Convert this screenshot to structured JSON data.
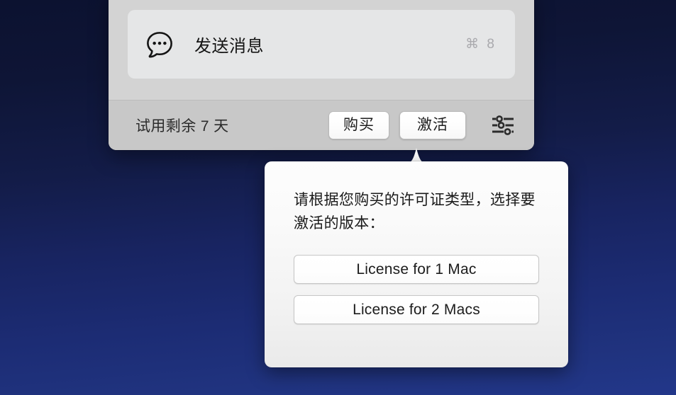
{
  "window": {
    "menu_item": {
      "icon": "chat-bubble-icon",
      "label": "发送消息",
      "shortcut": "⌘ 8"
    },
    "toolbar": {
      "trial_status": "试用剩余 7 天",
      "buy_label": "购买",
      "activate_label": "激活",
      "settings_icon": "sliders-icon"
    }
  },
  "popover": {
    "message": "请根据您购买的许可证类型，选择要激活的版本：",
    "options": [
      {
        "label": "License for 1 Mac"
      },
      {
        "label": "License for 2 Macs"
      }
    ]
  },
  "colors": {
    "desktop_top": "#0c1230",
    "desktop_bottom": "#22378a",
    "window_bg": "#d3d3d3",
    "toolbar_bg": "#c8c8c8",
    "card_bg": "#e5e6e7",
    "popover_bg": "#fafafa",
    "text_primary": "#1a1a1a",
    "shortcut_gray": "#a9a9ad"
  }
}
